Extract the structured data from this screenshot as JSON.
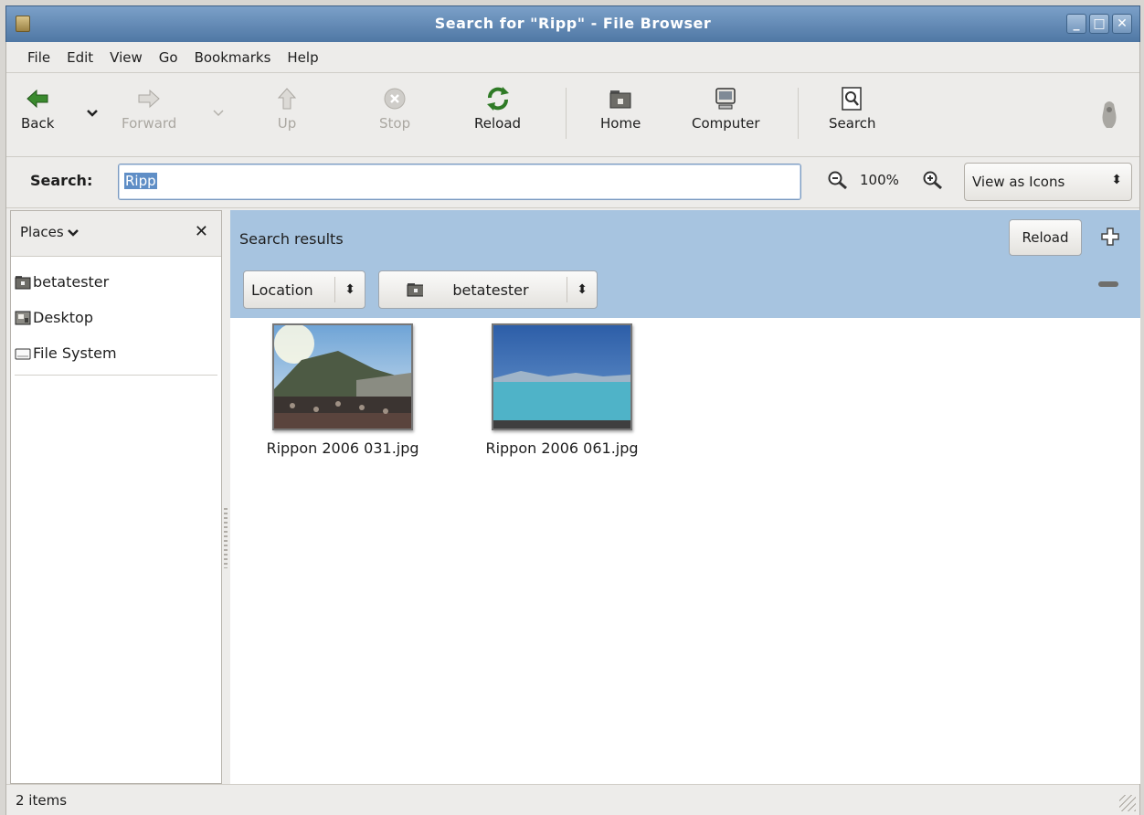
{
  "window": {
    "title": "Search for \"Ripp\" - File Browser",
    "controls": {
      "minimize": "_",
      "maximize": "□",
      "close": "✕"
    }
  },
  "menu": [
    "File",
    "Edit",
    "View",
    "Go",
    "Bookmarks",
    "Help"
  ],
  "toolbar": {
    "back": "Back",
    "forward": "Forward",
    "up": "Up",
    "stop": "Stop",
    "reload": "Reload",
    "home": "Home",
    "computer": "Computer",
    "search": "Search"
  },
  "searchbar": {
    "label": "Search:",
    "value": "Ripp",
    "zoom": "100%",
    "view_mode": "View as Icons"
  },
  "sidebar": {
    "header": "Places",
    "items": [
      {
        "label": "betatester",
        "icon": "home-folder-icon"
      },
      {
        "label": "Desktop",
        "icon": "desktop-icon"
      },
      {
        "label": "File System",
        "icon": "drive-icon"
      }
    ]
  },
  "search_panel": {
    "title": "Search results",
    "reload_label": "Reload",
    "criterion": "Location",
    "location_value": "betatester"
  },
  "files": [
    {
      "name": "Rippon 2006 031.jpg"
    },
    {
      "name": "Rippon 2006 061.jpg"
    }
  ],
  "status": {
    "text": "2 items"
  },
  "colors": {
    "titlebar": "#5f86b3",
    "search_panel_bg": "#a7c4e0",
    "selection": "#5f8ec6"
  }
}
